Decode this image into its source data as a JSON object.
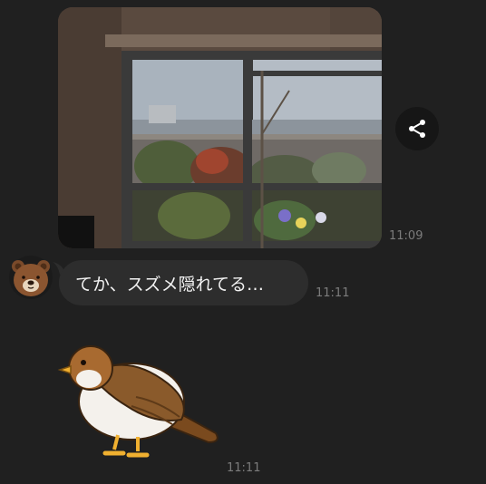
{
  "messages": {
    "photo": {
      "time": "11:09",
      "share_icon": "share-icon"
    },
    "text": {
      "body": "てか、スズメ隠れてる…",
      "time": "11:11",
      "avatar_icon": "brown-bear-avatar"
    },
    "sticker": {
      "time": "11:11",
      "icon": "sparrow-sticker"
    }
  },
  "colors": {
    "background": "#202020",
    "bubble": "#2d2d2d",
    "timestamp": "#7c7c7c",
    "text": "#f2f2f2"
  }
}
